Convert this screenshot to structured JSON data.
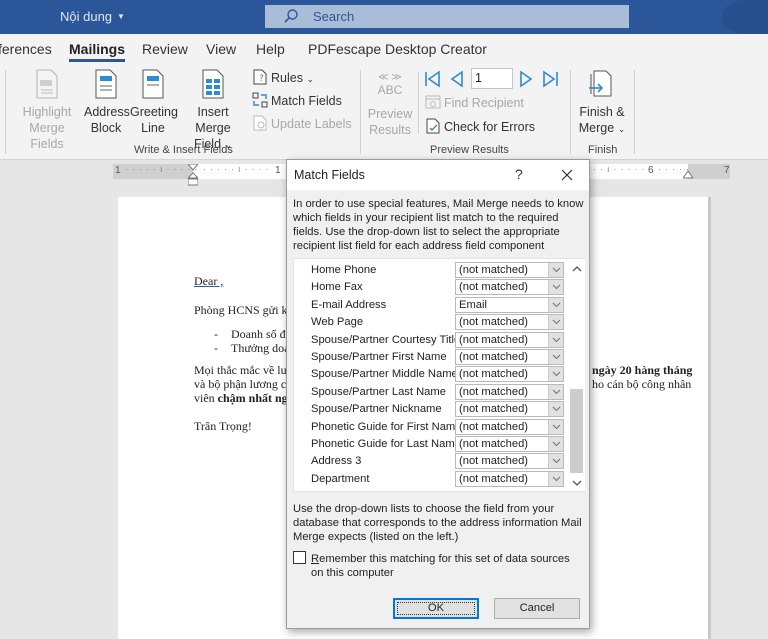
{
  "titlebar": {
    "document_name": "Nội dung",
    "search_placeholder": "Search"
  },
  "tabs": [
    {
      "label": "ferences"
    },
    {
      "label": "Mailings",
      "active": true
    },
    {
      "label": "Review"
    },
    {
      "label": "View"
    },
    {
      "label": "Help"
    },
    {
      "label": "PDFescape Desktop Creator"
    }
  ],
  "ribbon": {
    "write_insert": {
      "group_label": "Write & Insert Fields",
      "highlight": {
        "line1": "Highlight",
        "line2": "Merge Fields",
        "enabled": false
      },
      "address_block": {
        "line1": "Address",
        "line2": "Block"
      },
      "greeting_line": {
        "line1": "Greeting",
        "line2": "Line"
      },
      "insert_merge_field": {
        "line1": "Insert Merge",
        "line2": "Field"
      },
      "rules": "Rules",
      "match_fields": "Match Fields",
      "update_labels": {
        "label": "Update Labels",
        "enabled": false
      }
    },
    "preview": {
      "group_label": "Preview Results",
      "abc_chevrons": "≪ ≫",
      "abc": "ABC",
      "preview_results": {
        "line1": "Preview",
        "line2": "Results",
        "enabled": false
      },
      "record_number": "1",
      "find_recipient": {
        "label": "Find Recipient",
        "enabled": false
      },
      "check_errors": "Check for Errors"
    },
    "finish": {
      "group_label": "Finish",
      "finish_merge": {
        "line1": "Finish &",
        "line2": "Merge"
      }
    }
  },
  "ruler": {
    "labels": [
      "1",
      "1",
      "6",
      "7"
    ]
  },
  "document": {
    "greeting": "Dear ,",
    "line1": "Phòng HCNS gửi k",
    "bullet1": "Doanh số đ",
    "bullet2": "Thưởng doa",
    "bullet_marker": "-",
    "para_line1_start": "Mọi thắc mắc về lư",
    "para_line1_end_bold": "ngày 20 hàng tháng",
    "para_line2_start": "và bộ phận lương c",
    "para_line2_end": "ho cán bộ công nhân",
    "para_line3_start": "viên ",
    "para_line3_bold": "chậm nhất ng",
    "closing": "Trân Trọng!"
  },
  "dialog": {
    "title": "Match Fields",
    "help": "?",
    "intro": "In order to use special features, Mail Merge needs to know which fields in your recipient list match to the required fields. Use the drop-down list to select the appropriate recipient list field for each address field component",
    "fields": [
      {
        "label": "Home Phone",
        "value": "(not matched)"
      },
      {
        "label": "Home Fax",
        "value": "(not matched)"
      },
      {
        "label": "E-mail Address",
        "value": "Email"
      },
      {
        "label": "Web Page",
        "value": "(not matched)"
      },
      {
        "label": "Spouse/Partner Courtesy Title",
        "value": "(not matched)"
      },
      {
        "label": "Spouse/Partner First Name",
        "value": "(not matched)"
      },
      {
        "label": "Spouse/Partner Middle Name",
        "value": "(not matched)"
      },
      {
        "label": "Spouse/Partner Last Name",
        "value": "(not matched)"
      },
      {
        "label": "Spouse/Partner Nickname",
        "value": "(not matched)"
      },
      {
        "label": "Phonetic Guide for First Name",
        "value": "(not matched)"
      },
      {
        "label": "Phonetic Guide for Last Name",
        "value": "(not matched)"
      },
      {
        "label": "Address 3",
        "value": "(not matched)"
      },
      {
        "label": "Department",
        "value": "(not matched)"
      }
    ],
    "note": "Use the drop-down lists to choose the field from your database that corresponds to the address information Mail Merge expects (listed on the left.)",
    "remember_first_letter": "R",
    "remember_rest": "emember this matching for this set of data sources on this computer",
    "remember_checked": false,
    "ok_label": "OK",
    "cancel_label": "Cancel"
  },
  "colors": {
    "titlebar": "#2b579a",
    "accent_icon": "#2e8bd0",
    "dialog_bg": "#f0f0f0"
  }
}
